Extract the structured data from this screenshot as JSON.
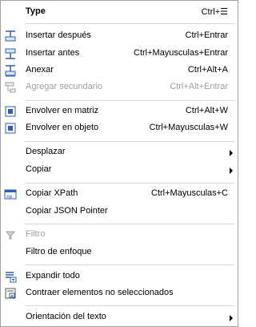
{
  "menu": {
    "type": {
      "label": "Type",
      "shortcut": "Ctrl+☰"
    },
    "insertar_despues": {
      "label": "Insertar después",
      "shortcut": "Ctrl+Entrar"
    },
    "insertar_antes": {
      "label": "Insertar antes",
      "shortcut": "Ctrl+Mayusculas+Entrar"
    },
    "anexar": {
      "label": "Anexar",
      "shortcut": "Ctrl+Alt+A"
    },
    "agregar_secundario": {
      "label": "Agregar secundario",
      "shortcut": "Ctrl+Alt+Entrar",
      "disabled": true
    },
    "envolver_matriz": {
      "label": "Envolver en matriz",
      "shortcut": "Ctrl+Alt+W"
    },
    "envolver_objeto": {
      "label": "Envolver en objeto",
      "shortcut": "Ctrl+Mayusculas+W"
    },
    "desplazar": {
      "label": "Desplazar"
    },
    "copiar": {
      "label": "Copiar"
    },
    "copiar_xpath": {
      "label": "Copiar XPath",
      "shortcut": "Ctrl+Mayusculas+C"
    },
    "copiar_json_pointer": {
      "label": "Copiar JSON Pointer"
    },
    "filtro": {
      "label": "Filtro",
      "disabled": true
    },
    "filtro_enfoque": {
      "label": "Filtro de enfoque"
    },
    "expandir_todo": {
      "label": "Expandir todo"
    },
    "contraer": {
      "label": "Contraer elementos no seleccionados"
    },
    "orientacion": {
      "label": "Orientación del texto"
    }
  },
  "colors": {
    "icon_blue": "#2f5fb0",
    "disabled_gray": "#a0a0a0",
    "separator": "#d7d7d7"
  }
}
